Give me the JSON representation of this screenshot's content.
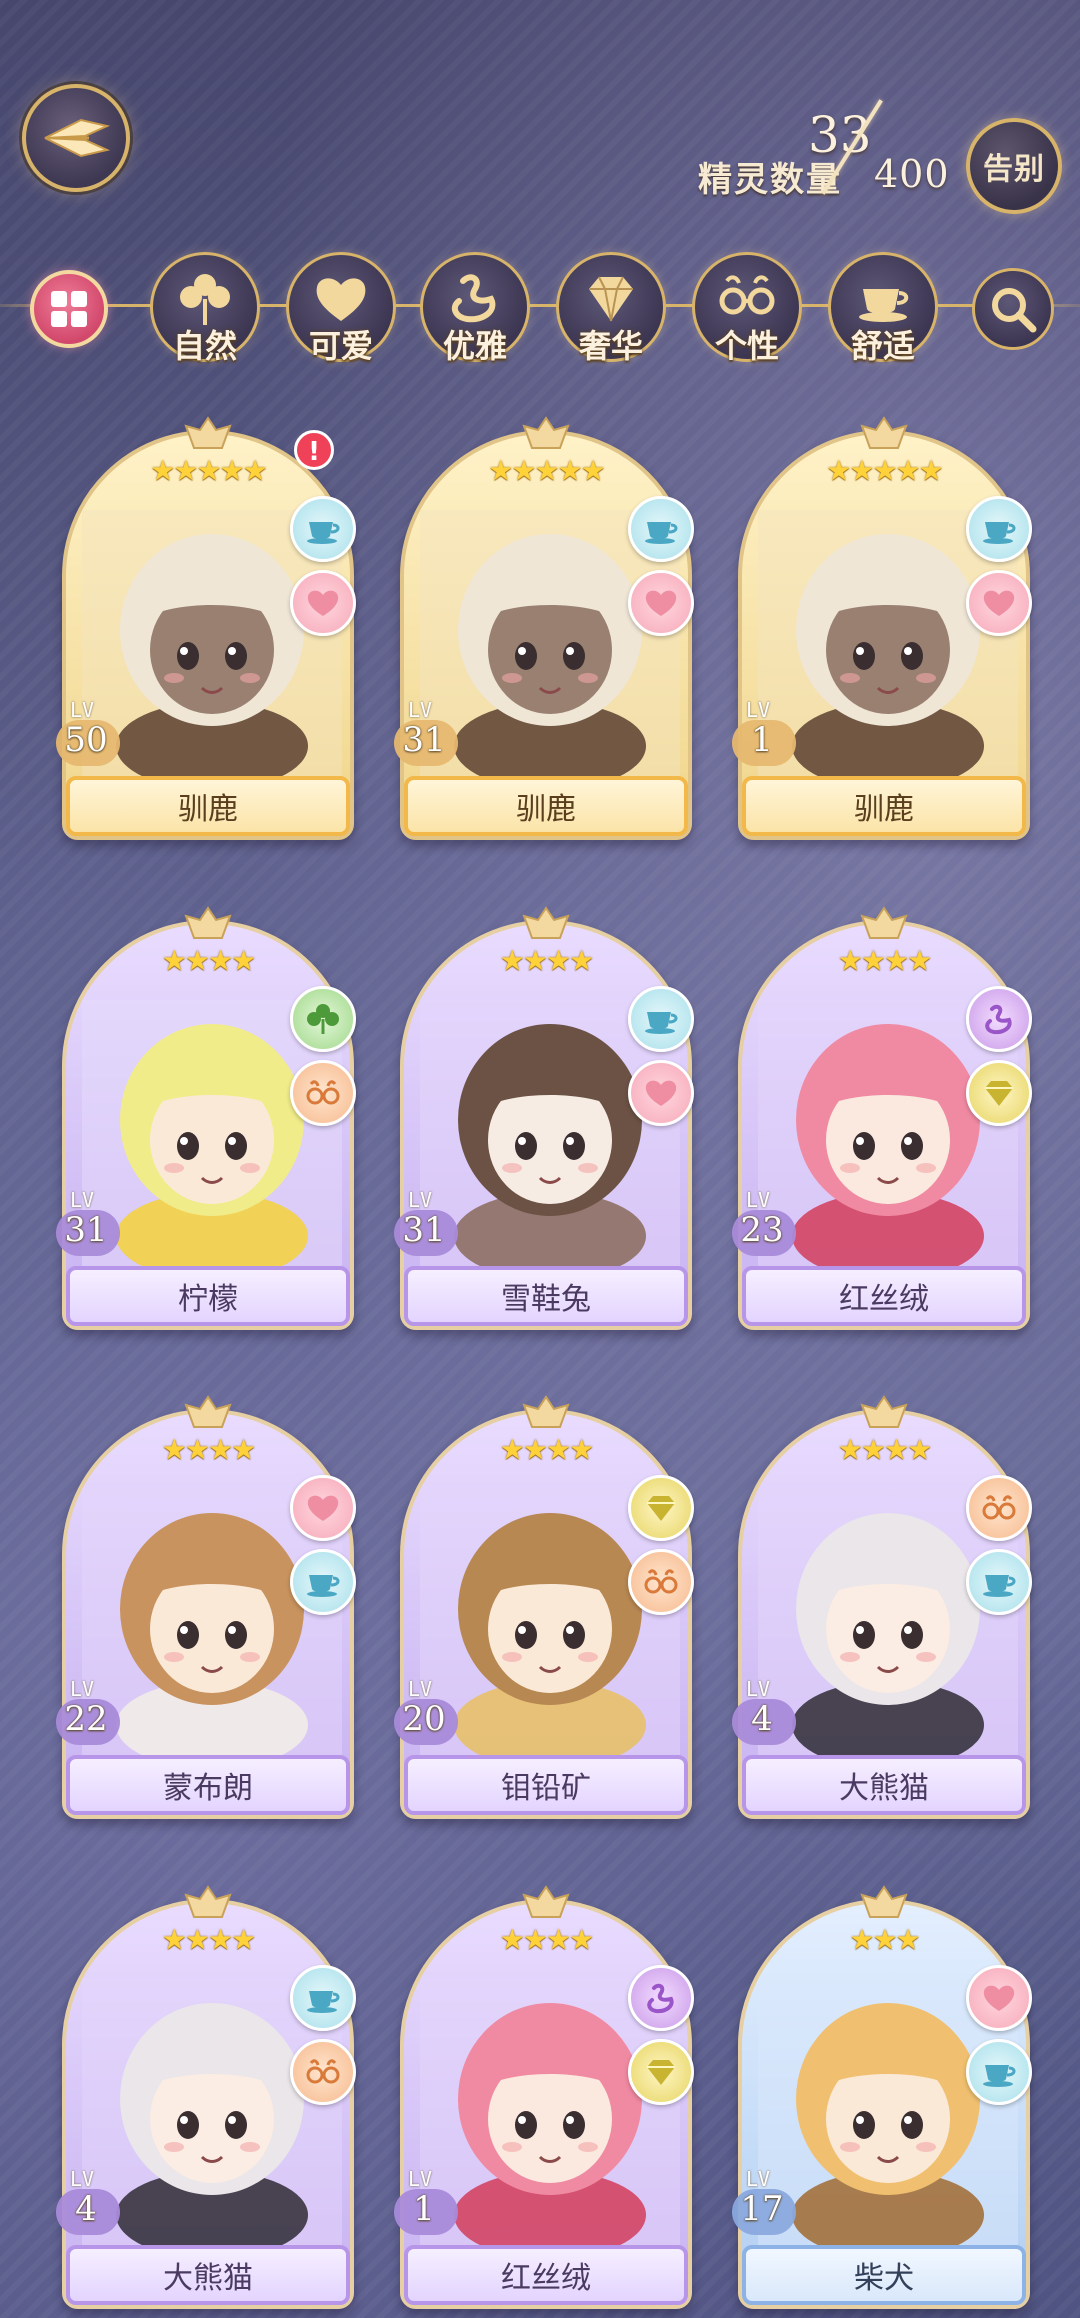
{
  "header": {
    "back_icon": "wing-back-icon",
    "count_label": "精灵数量",
    "count_current": "33",
    "count_max": "400",
    "farewell_label": "告别"
  },
  "filters": {
    "all_icon": "gift-grid-icon",
    "search_icon": "magnifier-icon",
    "items": [
      {
        "label": "自然",
        "icon": "clover-icon"
      },
      {
        "label": "可爱",
        "icon": "heart-icon"
      },
      {
        "label": "优雅",
        "icon": "swan-icon"
      },
      {
        "label": "奢华",
        "icon": "diamond-icon"
      },
      {
        "label": "个性",
        "icon": "glasses-icon"
      },
      {
        "label": "舒适",
        "icon": "teacup-icon"
      }
    ]
  },
  "cards": [
    {
      "name": "驯鹿",
      "lv_prefix": "LV",
      "level": "50",
      "stars": "★★★★★",
      "rarity": 5,
      "theme": "gold",
      "alert": "!",
      "tags": [
        "comfort",
        "cute"
      ]
    },
    {
      "name": "驯鹿",
      "lv_prefix": "LV",
      "level": "31",
      "stars": "★★★★★",
      "rarity": 5,
      "theme": "gold",
      "alert": "",
      "tags": [
        "comfort",
        "cute"
      ]
    },
    {
      "name": "驯鹿",
      "lv_prefix": "LV",
      "level": "1",
      "stars": "★★★★★",
      "rarity": 5,
      "theme": "gold",
      "alert": "",
      "tags": [
        "comfort",
        "cute"
      ]
    },
    {
      "name": "柠檬",
      "lv_prefix": "LV",
      "level": "31",
      "stars": "★★★★",
      "rarity": 4,
      "theme": "purple",
      "alert": "",
      "tags": [
        "nature",
        "personality"
      ]
    },
    {
      "name": "雪鞋兔",
      "lv_prefix": "LV",
      "level": "31",
      "stars": "★★★★",
      "rarity": 4,
      "theme": "purple",
      "alert": "",
      "tags": [
        "comfort",
        "cute"
      ]
    },
    {
      "name": "红丝绒",
      "lv_prefix": "LV",
      "level": "23",
      "stars": "★★★★",
      "rarity": 4,
      "theme": "purple",
      "alert": "",
      "tags": [
        "elegant",
        "luxury"
      ]
    },
    {
      "name": "蒙布朗",
      "lv_prefix": "LV",
      "level": "22",
      "stars": "★★★★",
      "rarity": 4,
      "theme": "purple",
      "alert": "",
      "tags": [
        "cute",
        "comfort"
      ]
    },
    {
      "name": "钼铅矿",
      "lv_prefix": "LV",
      "level": "20",
      "stars": "★★★★",
      "rarity": 4,
      "theme": "purple",
      "alert": "",
      "tags": [
        "luxury",
        "personality"
      ]
    },
    {
      "name": "大熊猫",
      "lv_prefix": "LV",
      "level": "4",
      "stars": "★★★★",
      "rarity": 4,
      "theme": "purple",
      "alert": "",
      "tags": [
        "personality",
        "comfort"
      ]
    },
    {
      "name": "大熊猫",
      "lv_prefix": "LV",
      "level": "4",
      "stars": "★★★★",
      "rarity": 4,
      "theme": "purple",
      "alert": "",
      "tags": [
        "comfort",
        "personality"
      ]
    },
    {
      "name": "红丝绒",
      "lv_prefix": "LV",
      "level": "1",
      "stars": "★★★★",
      "rarity": 4,
      "theme": "purple",
      "alert": "",
      "tags": [
        "elegant",
        "luxury"
      ]
    },
    {
      "name": "柴犬",
      "lv_prefix": "LV",
      "level": "17",
      "stars": "★★★",
      "rarity": 3,
      "theme": "blue",
      "alert": "",
      "tags": [
        "cute",
        "comfort"
      ]
    }
  ],
  "colors": {
    "gold": "#d8b46a",
    "accent_pink": "#ef4259",
    "background": "#575b86"
  }
}
